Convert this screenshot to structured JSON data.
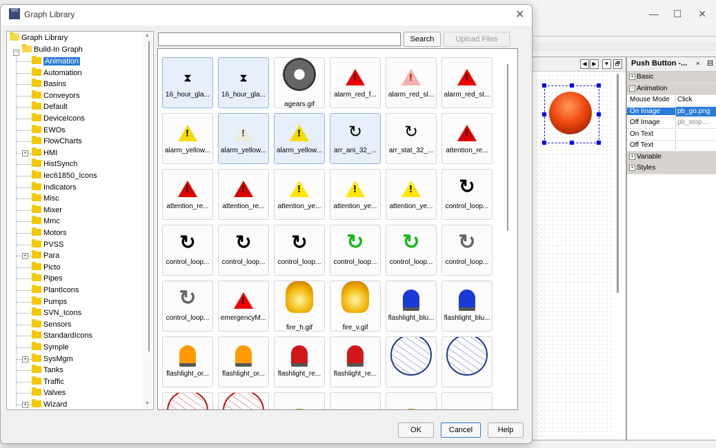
{
  "background": {
    "canvas_panel": {
      "nav_buttons": [
        "◀",
        "▶",
        "▼",
        "🗗"
      ]
    },
    "properties": {
      "title": "Push Button -...",
      "close": "×",
      "pin": "⊟",
      "rows": [
        {
          "kind": "section",
          "key": "Basic",
          "expander": "+"
        },
        {
          "kind": "section",
          "key": "Animation",
          "expander": "−"
        },
        {
          "kind": "prop",
          "key": "Mouse Mode",
          "value": "Click"
        },
        {
          "kind": "prop",
          "key": "On Image",
          "value": "pb_go.png",
          "selected": true
        },
        {
          "kind": "prop",
          "key": "Off Image",
          "value": "pb_stop...."
        },
        {
          "kind": "prop",
          "key": "On Text",
          "value": ""
        },
        {
          "kind": "prop",
          "key": "Off Text",
          "value": ""
        },
        {
          "kind": "section",
          "key": "Variable",
          "expander": "+"
        },
        {
          "kind": "section",
          "key": "Styles",
          "expander": "+"
        }
      ]
    },
    "window_controls": {
      "minimize": "—",
      "maximize": "☐",
      "close": "✕"
    }
  },
  "dialog": {
    "title": "Graph Library",
    "icon_text": "WS",
    "close_glyph": "✕",
    "search": {
      "placeholder": "",
      "value": "",
      "search_button": "Search",
      "upload_button": "Upload Files"
    },
    "tree": {
      "root": "Graph Library",
      "group": "Build-In Graph",
      "items": [
        {
          "label": "Animation",
          "selected": true
        },
        {
          "label": "Automation"
        },
        {
          "label": "Basins"
        },
        {
          "label": "Conveyors"
        },
        {
          "label": "Default"
        },
        {
          "label": "DeviceIcons"
        },
        {
          "label": "EWOs"
        },
        {
          "label": "FlowCharts"
        },
        {
          "label": "HMI",
          "expandable": true
        },
        {
          "label": "HistSynch"
        },
        {
          "label": "Iec61850_Icons"
        },
        {
          "label": "Indicators"
        },
        {
          "label": "Misc"
        },
        {
          "label": "Mixer"
        },
        {
          "label": "Mmc"
        },
        {
          "label": "Motors"
        },
        {
          "label": "PVSS"
        },
        {
          "label": "Para",
          "expandable": true
        },
        {
          "label": "Picto"
        },
        {
          "label": "Pipes"
        },
        {
          "label": "PlantIcons"
        },
        {
          "label": "Pumps"
        },
        {
          "label": "SVN_Icons"
        },
        {
          "label": "Sensors"
        },
        {
          "label": "StandardIcons"
        },
        {
          "label": "Symple"
        },
        {
          "label": "SysMgm",
          "expandable": true
        },
        {
          "label": "Tanks"
        },
        {
          "label": "Traffic"
        },
        {
          "label": "Valves"
        },
        {
          "label": "Wizard",
          "expandable": true
        }
      ]
    },
    "gallery": [
      {
        "label": "16_hour_gla...",
        "icon": "hourglass-icon",
        "selected": true
      },
      {
        "label": "16_hour_gla...",
        "icon": "hourglass-icon",
        "selected": true
      },
      {
        "label": "agears.gif",
        "icon": "gears-icon",
        "tall": true
      },
      {
        "label": "alarm_red_f...",
        "icon": "alarm-red-icon"
      },
      {
        "label": "alarm_red_sl...",
        "icon": "alarm-red-light-icon"
      },
      {
        "label": "alarm_red_st...",
        "icon": "alarm-red-icon"
      },
      {
        "label": "alarm_yellow...",
        "icon": "alarm-yellow-icon"
      },
      {
        "label": "alarm_yellow...",
        "icon": "alarm-yellow-light-icon",
        "selected": true
      },
      {
        "label": "alarm_yellow...",
        "icon": "alarm-yellow-icon",
        "selected": true
      },
      {
        "label": "arr_ani_32_...",
        "icon": "rotate-arrow-icon",
        "selected": true
      },
      {
        "label": "arr_stat_32_...",
        "icon": "rotate-arrow-icon"
      },
      {
        "label": "attention_re...",
        "icon": "attention-red-icon"
      },
      {
        "label": "attention_re...",
        "icon": "attention-red-icon"
      },
      {
        "label": "attention_re...",
        "icon": "attention-red-icon"
      },
      {
        "label": "attention_ye...",
        "icon": "attention-yellow-icon"
      },
      {
        "label": "attention_ye...",
        "icon": "attention-yellow-icon"
      },
      {
        "label": "attention_ye...",
        "icon": "attention-yellow-icon"
      },
      {
        "label": "control_loop...",
        "icon": "control-loop-icon"
      },
      {
        "label": "control_loop...",
        "icon": "control-loop-icon"
      },
      {
        "label": "control_loop...",
        "icon": "control-loop-icon"
      },
      {
        "label": "control_loop...",
        "icon": "control-loop-icon"
      },
      {
        "label": "control_loop...",
        "icon": "control-loop-green-icon"
      },
      {
        "label": "control_loop...",
        "icon": "control-loop-green-icon"
      },
      {
        "label": "control_loop...",
        "icon": "control-loop-grey-icon"
      },
      {
        "label": "control_loop...",
        "icon": "control-loop-grey-icon"
      },
      {
        "label": "emergencyM...",
        "icon": "alarm-red-icon"
      },
      {
        "label": "fire_h.gif",
        "icon": "fire-icon",
        "tall": true
      },
      {
        "label": "fire_v.gif",
        "icon": "fire-icon",
        "tall": true
      },
      {
        "label": "flashlight_blu...",
        "icon": "flashlight-blue-icon"
      },
      {
        "label": "flashlight_blu...",
        "icon": "flashlight-blue-icon"
      },
      {
        "label": "flashlight_or...",
        "icon": "flashlight-orange-icon"
      },
      {
        "label": "flashlight_or...",
        "icon": "flashlight-orange-icon"
      },
      {
        "label": "flashlight_re...",
        "icon": "flashlight-red-icon"
      },
      {
        "label": "flashlight_re...",
        "icon": "flashlight-red-icon"
      },
      {
        "label": "",
        "icon": "globe-blue-icon"
      },
      {
        "label": "",
        "icon": "globe-blue-icon"
      },
      {
        "label": "",
        "icon": "globe-red-icon"
      },
      {
        "label": "",
        "icon": "globe-red-icon"
      },
      {
        "label": "",
        "icon": "hourglass-gold-icon"
      },
      {
        "label": "",
        "icon": "arrow-grey-icon"
      },
      {
        "label": "",
        "icon": "hourglass-gold-icon"
      },
      {
        "label": "",
        "icon": "hourglass-icon"
      }
    ],
    "footer": {
      "ok": "OK",
      "cancel": "Cancel",
      "help": "Help"
    }
  },
  "colors": {
    "selection": "#2a7bd8",
    "tile_selected": "#e6effa",
    "folder": "#f5c800"
  }
}
